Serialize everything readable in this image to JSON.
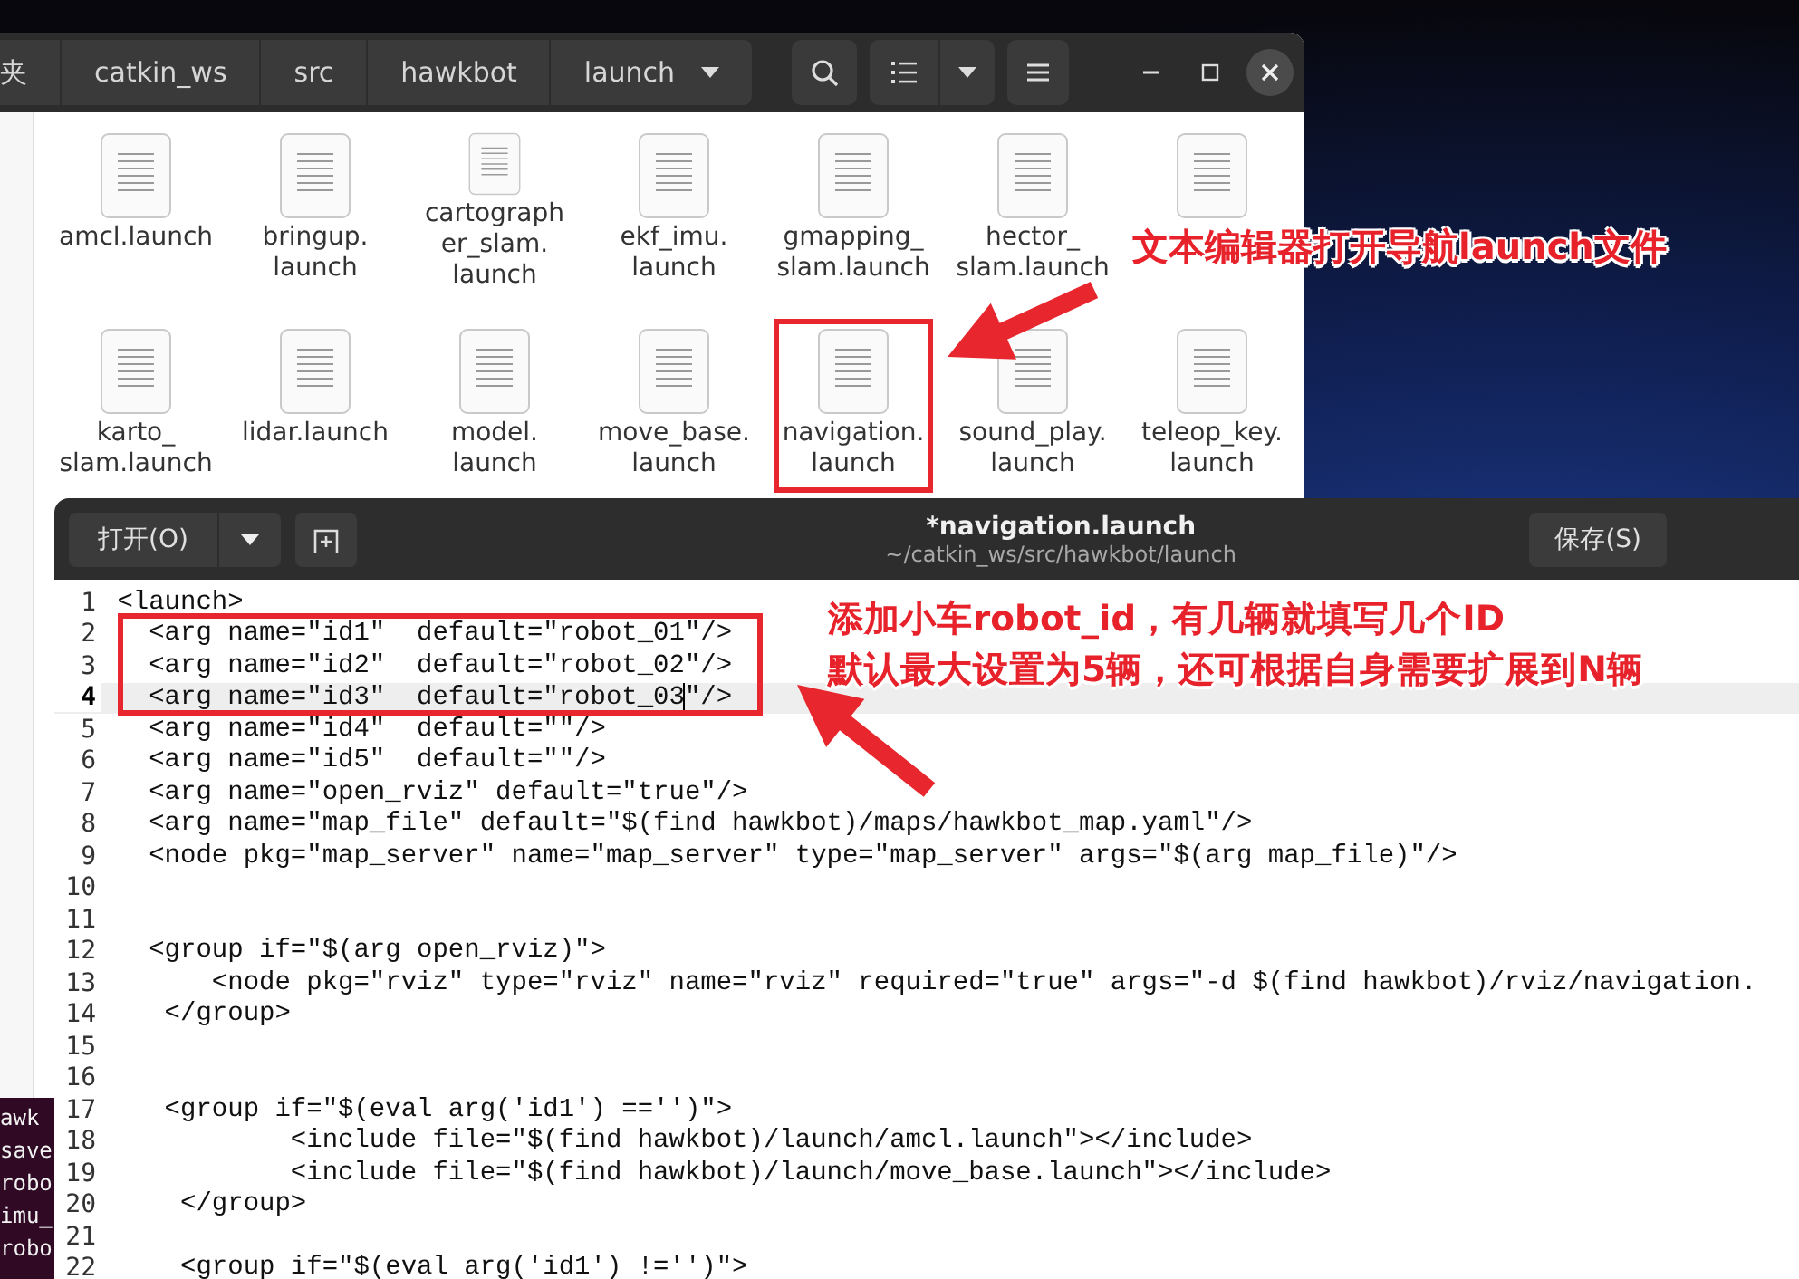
{
  "file_manager": {
    "path": [
      {
        "label": "夹",
        "dropdown": false
      },
      {
        "label": "catkin_ws",
        "dropdown": false
      },
      {
        "label": "src",
        "dropdown": false
      },
      {
        "label": "hawkbot",
        "dropdown": false
      },
      {
        "label": "launch",
        "dropdown": true
      }
    ],
    "files": [
      {
        "name": "amcl.launch",
        "marked": false
      },
      {
        "name": "bringup.\nlaunch",
        "marked": false
      },
      {
        "name": "cartograph\ner_slam.\nlaunch",
        "marked": false
      },
      {
        "name": "ekf_imu.\nlaunch",
        "marked": false
      },
      {
        "name": "gmapping_\nslam.launch",
        "marked": false
      },
      {
        "name": "hector_\nslam.launch",
        "marked": false
      },
      {
        "marked": false
      },
      {
        "name": "karto_\nslam.launch",
        "marked": false
      },
      {
        "name": "lidar.launch",
        "marked": false
      },
      {
        "name": "model.\nlaunch",
        "marked": false
      },
      {
        "name": "move_base.\nlaunch",
        "marked": false
      },
      {
        "name": "navigation.\nlaunch",
        "marked": true
      },
      {
        "name": "sound_play.\nlaunch",
        "marked": false
      },
      {
        "name": "teleop_key.\nlaunch",
        "marked": false
      }
    ]
  },
  "editor": {
    "open_button": "打开(O)",
    "title": "*navigation.launch",
    "subtitle": "~/catkin_ws/src/hawkbot/launch",
    "save_button": "保存(S)",
    "lines": [
      {
        "number": "1",
        "text": "<launch>",
        "current": false
      },
      {
        "number": "2",
        "text": "  <arg name=\"id1\"  default=\"robot_01\"/>",
        "current": false
      },
      {
        "number": "3",
        "text": "  <arg name=\"id2\"  default=\"robot_02\"/>",
        "current": false
      },
      {
        "number": "4",
        "text": "  <arg name=\"id3\"  default=\"robot_03\"/>",
        "current": true
      },
      {
        "number": "5",
        "text": "  <arg name=\"id4\"  default=\"\"/>",
        "current": false
      },
      {
        "number": "6",
        "text": "  <arg name=\"id5\"  default=\"\"/>",
        "current": false
      },
      {
        "number": "7",
        "text": "  <arg name=\"open_rviz\" default=\"true\"/>",
        "current": false
      },
      {
        "number": "8",
        "text": "  <arg name=\"map_file\" default=\"$(find hawkbot)/maps/hawkbot_map.yaml\"/>",
        "current": false
      },
      {
        "number": "9",
        "text": "  <node pkg=\"map_server\" name=\"map_server\" type=\"map_server\" args=\"$(arg map_file)\"/>",
        "current": false
      },
      {
        "number": "10",
        "current": false
      },
      {
        "number": "11",
        "current": false
      },
      {
        "number": "12",
        "text": "  <group if=\"$(arg open_rviz)\">",
        "current": false
      },
      {
        "number": "13",
        "text": "      <node pkg=\"rviz\" type=\"rviz\" name=\"rviz\" required=\"true\" args=\"-d $(find hawkbot)/rviz/navigation.",
        "current": false
      },
      {
        "number": "14",
        "text": "   </group>",
        "current": false
      },
      {
        "number": "15",
        "current": false
      },
      {
        "number": "16",
        "current": false
      },
      {
        "number": "17",
        "text": "   <group if=\"$(eval arg('id1') =='')\">",
        "current": false
      },
      {
        "number": "18",
        "text": "           <include file=\"$(find hawkbot)/launch/amcl.launch\"></include>",
        "current": false
      },
      {
        "number": "19",
        "text": "           <include file=\"$(find hawkbot)/launch/move_base.launch\"></include>",
        "current": false
      },
      {
        "number": "20",
        "text": "    </group>",
        "current": false
      },
      {
        "number": "21",
        "current": false
      },
      {
        "number": "22",
        "text": "    <group if=\"$(eval arg('id1') !='')\">",
        "current": false
      }
    ]
  },
  "terminal": {
    "lines": [
      "awk",
      "save",
      "robo",
      "imu_",
      "robo"
    ]
  },
  "annotations": {
    "file_callout": "文本编辑器打开导航launch文件",
    "id_callout": [
      "添加小车robot_id，有几辆就填写几个ID",
      "默认最大设置为5辆，还可根据自身需要扩展到N辆"
    ]
  }
}
